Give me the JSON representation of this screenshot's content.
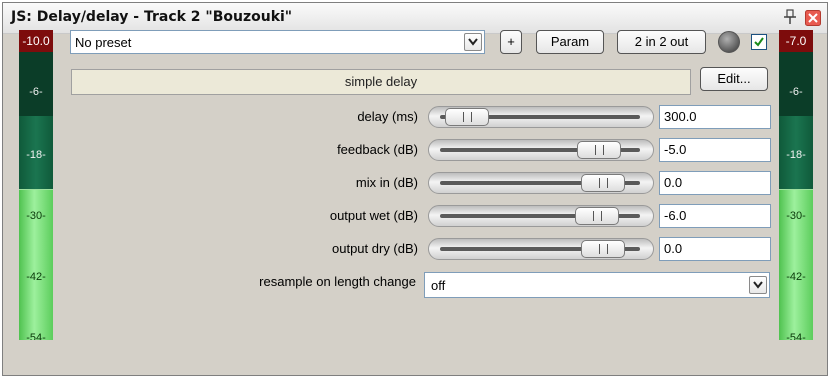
{
  "window": {
    "title": "JS: Delay/delay - Track 2 \"Bouzouki\""
  },
  "meters": {
    "left": {
      "peak": "-10.0",
      "ticks": [
        "-6-",
        "-18-",
        "-30-",
        "-42-",
        "-54-"
      ]
    },
    "right": {
      "peak": "-7.0",
      "ticks": [
        "-6-",
        "-18-",
        "-30-",
        "-42-",
        "-54-"
      ]
    }
  },
  "toolbar": {
    "preset": "No preset",
    "plus_label": "+",
    "param_label": "Param",
    "io_label": "2 in 2 out",
    "bypass_checked": true
  },
  "plugin": {
    "name": "simple delay",
    "edit_label": "Edit..."
  },
  "params": [
    {
      "label": "delay (ms)",
      "value": "300.0",
      "level": 0.08
    },
    {
      "label": "feedback (dB)",
      "value": "-5.0",
      "level": 0.83
    },
    {
      "label": "mix in (dB)",
      "value": "0.0",
      "level": 0.85
    },
    {
      "label": "output wet (dB)",
      "value": "-6.0",
      "level": 0.82
    },
    {
      "label": "output dry (dB)",
      "value": "0.0",
      "level": 0.85
    }
  ],
  "resample": {
    "label": "resample on length change",
    "value": "off"
  }
}
